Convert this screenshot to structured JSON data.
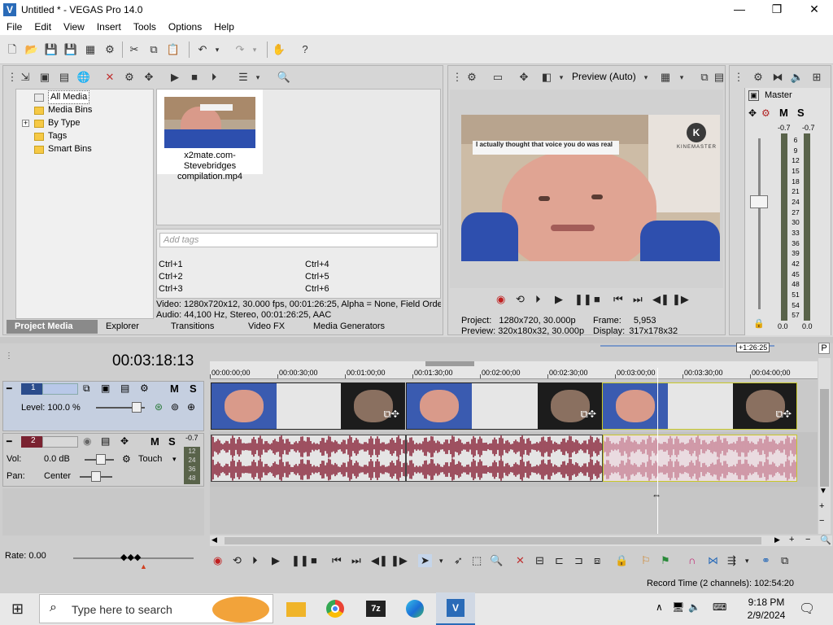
{
  "window": {
    "title": "Untitled * - VEGAS Pro 14.0",
    "minimize": "—",
    "maximize": "❐",
    "close": "✕"
  },
  "menu": [
    "File",
    "Edit",
    "View",
    "Insert",
    "Tools",
    "Options",
    "Help"
  ],
  "project_media": {
    "tree": [
      "All Media",
      "Media Bins",
      "By Type",
      "Tags",
      "Smart Bins"
    ],
    "expander": "+",
    "media_file": "x2mate.com-Stevebridges compilation.mp4",
    "tags_placeholder": "Add tags",
    "shortcuts": [
      "Ctrl+1",
      "Ctrl+2",
      "Ctrl+3",
      "Ctrl+4",
      "Ctrl+5",
      "Ctrl+6"
    ],
    "info_video": "Video: 1280x720x12, 30.000 fps, 00:01:26:25, Alpha = None, Field Orde",
    "info_audio": "Audio: 44,100 Hz, Stereo, 00:01:26:25, AAC",
    "tabs": [
      "Project Media",
      "Explorer",
      "Transitions",
      "Video FX",
      "Media Generators"
    ]
  },
  "preview": {
    "mode": "Preview (Auto)",
    "caption": "I actually thought that voice you do was real",
    "watermark": "KINEMASTER",
    "project_label": "Project:",
    "project_value": "1280x720, 30.000p",
    "preview_label": "Preview:",
    "preview_value": "320x180x32, 30.000p",
    "frame_label": "Frame:",
    "frame_value": "5,953",
    "display_label": "Display:",
    "display_value": "317x178x32"
  },
  "master": {
    "title": "Master",
    "peak_left": "-0.7",
    "peak_right": "-0.7",
    "scale": [
      "6",
      "9",
      "12",
      "15",
      "18",
      "21",
      "24",
      "27",
      "30",
      "33",
      "36",
      "39",
      "42",
      "45",
      "48",
      "51",
      "54",
      "57"
    ],
    "val_left": "0.0",
    "val_right": "0.0",
    "m": "M",
    "s": "S"
  },
  "timeline": {
    "timecode": "00:03:18:13",
    "ruler": [
      "00:00:00;00",
      "00:00:30;00",
      "00:01:00;00",
      "00:01:30;00",
      "00:02:00;00",
      "00:02:30;00",
      "00:03:00;00",
      "00:03:30;00",
      "00:04:00;00"
    ],
    "loop_length": "+1:26:25",
    "video_track": {
      "number": "1",
      "level": "Level: 100.0 %",
      "m": "M",
      "s": "S"
    },
    "audio_track": {
      "number": "2",
      "vol_label": "Vol:",
      "vol_value": "0.0 dB",
      "pan_label": "Pan:",
      "pan_value": "Center",
      "automation": "Touch",
      "m": "M",
      "s": "S",
      "meter_peak": "-0.7",
      "meter_scale": [
        "12",
        "24",
        "36",
        "48"
      ]
    },
    "rate": "Rate: 0.00"
  },
  "status": {
    "record_time": "Record Time (2 channels): 102:54:20"
  },
  "taskbar": {
    "search_placeholder": "Type here to search",
    "time": "9:18 PM",
    "date": "2/9/2024",
    "app_7z": "7z"
  },
  "colors": {
    "accent": "#2a6bb8",
    "audio_wave": "#8b2a3e",
    "audio_wave_selected": "#c9899a",
    "clip_selected": "#c8c82a",
    "panel": "#d6d6d6"
  }
}
